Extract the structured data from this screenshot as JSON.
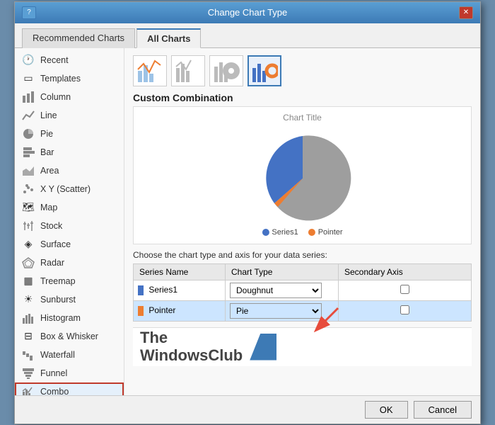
{
  "dialog": {
    "title": "Change Chart Type",
    "help_btn": "?",
    "close_btn": "✕"
  },
  "tabs": {
    "recommended": "Recommended Charts",
    "all": "All Charts"
  },
  "sidebar": {
    "items": [
      {
        "id": "recent",
        "label": "Recent",
        "icon": "🕐"
      },
      {
        "id": "templates",
        "label": "Templates",
        "icon": "▭"
      },
      {
        "id": "column",
        "label": "Column",
        "icon": "📊"
      },
      {
        "id": "line",
        "label": "Line",
        "icon": "📈"
      },
      {
        "id": "pie",
        "label": "Pie",
        "icon": "⬤"
      },
      {
        "id": "bar",
        "label": "Bar",
        "icon": "▬"
      },
      {
        "id": "area",
        "label": "Area",
        "icon": "📉"
      },
      {
        "id": "xy",
        "label": "X Y (Scatter)",
        "icon": "⁝"
      },
      {
        "id": "map",
        "label": "Map",
        "icon": "🗺"
      },
      {
        "id": "stock",
        "label": "Stock",
        "icon": "📋"
      },
      {
        "id": "surface",
        "label": "Surface",
        "icon": "◈"
      },
      {
        "id": "radar",
        "label": "Radar",
        "icon": "☆"
      },
      {
        "id": "treemap",
        "label": "Treemap",
        "icon": "▦"
      },
      {
        "id": "sunburst",
        "label": "Sunburst",
        "icon": "☀"
      },
      {
        "id": "histogram",
        "label": "Histogram",
        "icon": "▊"
      },
      {
        "id": "boxwhisker",
        "label": "Box & Whisker",
        "icon": "⊟"
      },
      {
        "id": "waterfall",
        "label": "Waterfall",
        "icon": "⇓"
      },
      {
        "id": "funnel",
        "label": "Funnel",
        "icon": "⊓"
      },
      {
        "id": "combo",
        "label": "Combo",
        "icon": "🔀"
      }
    ]
  },
  "main": {
    "section_title": "Custom Combination",
    "chart_title": "Chart Title",
    "legend": {
      "series1": "Series1",
      "pointer": "Pointer"
    },
    "instruction": "Choose the chart type and axis for your data series:",
    "table": {
      "headers": [
        "Series Name",
        "Chart Type",
        "Secondary Axis"
      ],
      "rows": [
        {
          "name": "Series1",
          "color": "#4472C4",
          "chartType": "Doughnut",
          "secondaryAxis": false
        },
        {
          "name": "Pointer",
          "color": "#ED7D31",
          "chartType": "Pie",
          "secondaryAxis": false,
          "highlighted": true
        }
      ]
    }
  },
  "footer": {
    "ok": "OK",
    "cancel": "Cancel"
  },
  "chart_icons": [
    "📊",
    "📊",
    "📊",
    "📊"
  ],
  "watermark": {
    "line1": "The",
    "line2": "WindowsClub"
  }
}
